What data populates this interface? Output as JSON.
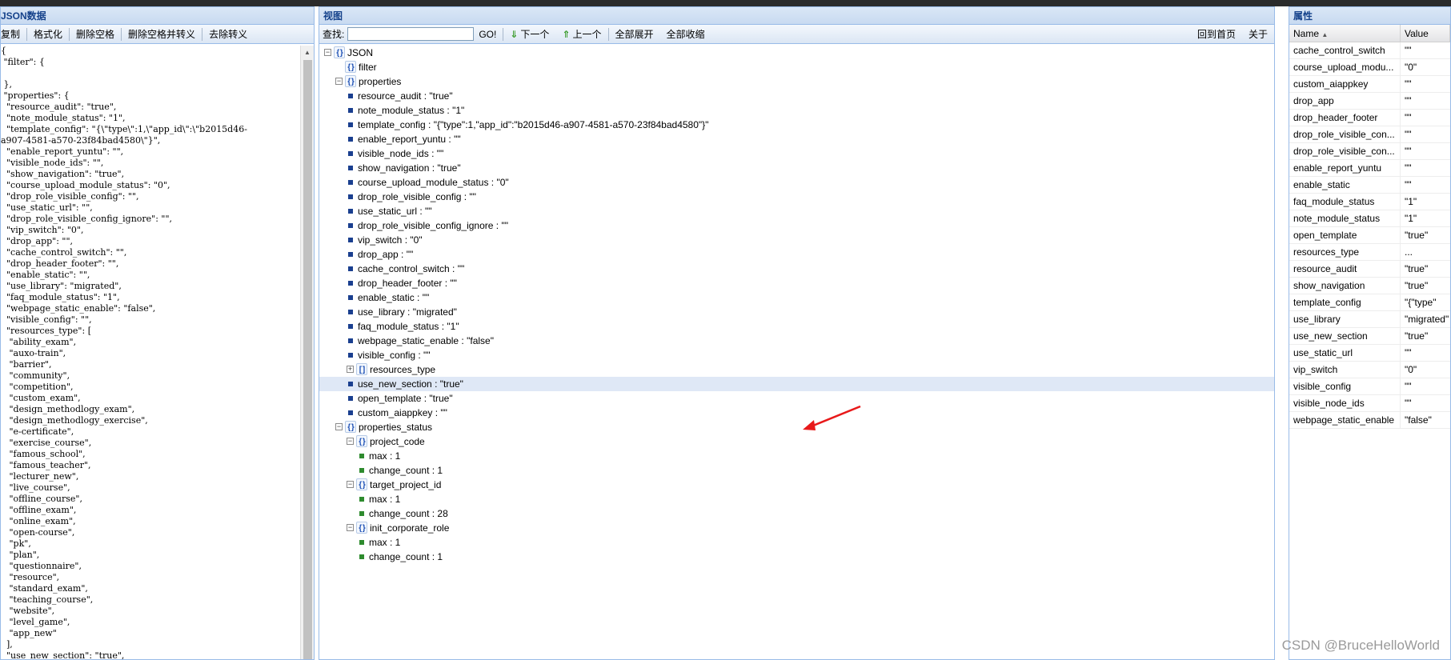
{
  "left_panel": {
    "title": "JSON数据",
    "toolbar": [
      "复制",
      "格式化",
      "删除空格",
      "删除空格并转义",
      "去除转义"
    ],
    "code_lines": [
      "{",
      " \"filter\": {",
      "",
      " },",
      " \"properties\": {",
      "  \"resource_audit\": \"true\",",
      "  \"note_module_status\": \"1\",",
      "  \"template_config\": \"{\\\"type\\\":1,\\\"app_id\\\":\\\"b2015d46-",
      "a907-4581-a570-23f84bad4580\\\"}\",",
      "  \"enable_report_yuntu\": \"\",",
      "  \"visible_node_ids\": \"\",",
      "  \"show_navigation\": \"true\",",
      "  \"course_upload_module_status\": \"0\",",
      "  \"drop_role_visible_config\": \"\",",
      "  \"use_static_url\": \"\",",
      "  \"drop_role_visible_config_ignore\": \"\",",
      "  \"vip_switch\": \"0\",",
      "  \"drop_app\": \"\",",
      "  \"cache_control_switch\": \"\",",
      "  \"drop_header_footer\": \"\",",
      "  \"enable_static\": \"\",",
      "  \"use_library\": \"migrated\",",
      "  \"faq_module_status\": \"1\",",
      "  \"webpage_static_enable\": \"false\",",
      "  \"visible_config\": \"\",",
      "  \"resources_type\": [",
      "   \"ability_exam\",",
      "   \"auxo-train\",",
      "   \"barrier\",",
      "   \"community\",",
      "   \"competition\",",
      "   \"custom_exam\",",
      "   \"design_methodlogy_exam\",",
      "   \"design_methodlogy_exercise\",",
      "   \"e-certificate\",",
      "   \"exercise_course\",",
      "   \"famous_school\",",
      "   \"famous_teacher\",",
      "   \"lecturer_new\",",
      "   \"live_course\",",
      "   \"offline_course\",",
      "   \"offline_exam\",",
      "   \"online_exam\",",
      "   \"open-course\",",
      "   \"pk\",",
      "   \"plan\",",
      "   \"questionnaire\",",
      "   \"resource\",",
      "   \"standard_exam\",",
      "   \"teaching_course\",",
      "   \"website\",",
      "   \"level_game\",",
      "   \"app_new\"",
      "  ],",
      "  \"use_new_section\": \"true\","
    ]
  },
  "middle_panel": {
    "title": "视图",
    "find_label": "查找:",
    "find_value": "",
    "go_label": "GO!",
    "next_label": "下一个",
    "prev_label": "上一个",
    "expand_all": "全部展开",
    "collapse_all": "全部收缩",
    "home_label": "回到首页",
    "about_label": "关于",
    "tree": [
      {
        "text": "JSON",
        "level": 0,
        "kind": "obj",
        "exp": "minus"
      },
      {
        "text": "filter",
        "level": 1,
        "kind": "obj",
        "exp": ""
      },
      {
        "text": "properties",
        "level": 1,
        "kind": "obj",
        "exp": "minus"
      },
      {
        "text": "resource_audit : \"true\"",
        "level": 2,
        "kind": "leaf"
      },
      {
        "text": "note_module_status : \"1\"",
        "level": 2,
        "kind": "leaf"
      },
      {
        "text": "template_config : \"{\"type\":1,\"app_id\":\"b2015d46-a907-4581-a570-23f84bad4580\"}\"",
        "level": 2,
        "kind": "leaf"
      },
      {
        "text": "enable_report_yuntu : \"\"",
        "level": 2,
        "kind": "leaf"
      },
      {
        "text": "visible_node_ids : \"\"",
        "level": 2,
        "kind": "leaf"
      },
      {
        "text": "show_navigation : \"true\"",
        "level": 2,
        "kind": "leaf"
      },
      {
        "text": "course_upload_module_status : \"0\"",
        "level": 2,
        "kind": "leaf"
      },
      {
        "text": "drop_role_visible_config : \"\"",
        "level": 2,
        "kind": "leaf"
      },
      {
        "text": "use_static_url : \"\"",
        "level": 2,
        "kind": "leaf"
      },
      {
        "text": "drop_role_visible_config_ignore : \"\"",
        "level": 2,
        "kind": "leaf"
      },
      {
        "text": "vip_switch : \"0\"",
        "level": 2,
        "kind": "leaf"
      },
      {
        "text": "drop_app : \"\"",
        "level": 2,
        "kind": "leaf"
      },
      {
        "text": "cache_control_switch : \"\"",
        "level": 2,
        "kind": "leaf"
      },
      {
        "text": "drop_header_footer : \"\"",
        "level": 2,
        "kind": "leaf"
      },
      {
        "text": "enable_static : \"\"",
        "level": 2,
        "kind": "leaf"
      },
      {
        "text": "use_library : \"migrated\"",
        "level": 2,
        "kind": "leaf"
      },
      {
        "text": "faq_module_status : \"1\"",
        "level": 2,
        "kind": "leaf"
      },
      {
        "text": "webpage_static_enable : \"false\"",
        "level": 2,
        "kind": "leaf"
      },
      {
        "text": "visible_config : \"\"",
        "level": 2,
        "kind": "leaf"
      },
      {
        "text": "resources_type",
        "level": 2,
        "kind": "arr",
        "exp": "plus"
      },
      {
        "text": "use_new_section : \"true\"",
        "level": 2,
        "kind": "leaf",
        "selected": true
      },
      {
        "text": "open_template : \"true\"",
        "level": 2,
        "kind": "leaf"
      },
      {
        "text": "custom_aiappkey : \"\"",
        "level": 2,
        "kind": "leaf"
      },
      {
        "text": "properties_status",
        "level": 1,
        "kind": "obj",
        "exp": "minus"
      },
      {
        "text": "project_code",
        "level": 2,
        "kind": "obj",
        "exp": "minus"
      },
      {
        "text": "max : 1",
        "level": 3,
        "kind": "leaf",
        "green": true
      },
      {
        "text": "change_count : 1",
        "level": 3,
        "kind": "leaf",
        "green": true
      },
      {
        "text": "target_project_id",
        "level": 2,
        "kind": "obj",
        "exp": "minus"
      },
      {
        "text": "max : 1",
        "level": 3,
        "kind": "leaf",
        "green": true
      },
      {
        "text": "change_count : 28",
        "level": 3,
        "kind": "leaf",
        "green": true
      },
      {
        "text": "init_corporate_role",
        "level": 2,
        "kind": "obj",
        "exp": "minus"
      },
      {
        "text": "max : 1",
        "level": 3,
        "kind": "leaf",
        "green": true
      },
      {
        "text": "change_count : 1",
        "level": 3,
        "kind": "leaf",
        "green": true
      }
    ],
    "annotation_arrow_color": "#e8191a"
  },
  "right_panel": {
    "title": "属性",
    "col_name": "Name",
    "col_value": "Value",
    "rows": [
      {
        "name": "cache_control_switch",
        "value": "\"\""
      },
      {
        "name": "course_upload_modu...",
        "value": "\"0\""
      },
      {
        "name": "custom_aiappkey",
        "value": "\"\""
      },
      {
        "name": "drop_app",
        "value": "\"\""
      },
      {
        "name": "drop_header_footer",
        "value": "\"\""
      },
      {
        "name": "drop_role_visible_con...",
        "value": "\"\""
      },
      {
        "name": "drop_role_visible_con...",
        "value": "\"\""
      },
      {
        "name": "enable_report_yuntu",
        "value": "\"\""
      },
      {
        "name": "enable_static",
        "value": "\"\""
      },
      {
        "name": "faq_module_status",
        "value": "\"1\""
      },
      {
        "name": "note_module_status",
        "value": "\"1\""
      },
      {
        "name": "open_template",
        "value": "\"true\""
      },
      {
        "name": "resources_type",
        "value": "..."
      },
      {
        "name": "resource_audit",
        "value": "\"true\""
      },
      {
        "name": "show_navigation",
        "value": "\"true\""
      },
      {
        "name": "template_config",
        "value": "\"{\"type\""
      },
      {
        "name": "use_library",
        "value": "\"migrated\""
      },
      {
        "name": "use_new_section",
        "value": "\"true\""
      },
      {
        "name": "use_static_url",
        "value": "\"\""
      },
      {
        "name": "vip_switch",
        "value": "\"0\""
      },
      {
        "name": "visible_config",
        "value": "\"\""
      },
      {
        "name": "visible_node_ids",
        "value": "\"\""
      },
      {
        "name": "webpage_static_enable",
        "value": "\"false\""
      }
    ]
  },
  "watermark": "CSDN @BruceHelloWorld"
}
